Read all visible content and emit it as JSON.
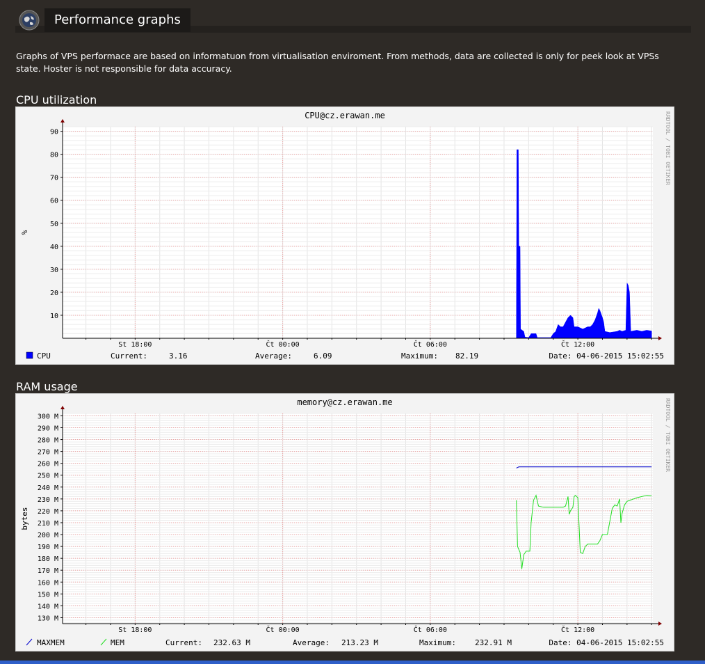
{
  "header": {
    "title": "Performance graphs",
    "icon": "globe-icon"
  },
  "intro": "Graphs of VPS performace are based on informatuon from virtualisation enviroment. From methods, data are collected is only for peek look at VPSs state. Hoster is not responsible for data accuracy.",
  "cpu": {
    "section_title": "CPU utilization",
    "chart_data": {
      "type": "area",
      "title": "CPU@cz.erawan.me",
      "ylabel": "%",
      "watermark": "RRDTOOL / TOBI OETIKER",
      "ylim": [
        0,
        92
      ],
      "yticks": [
        10,
        20,
        30,
        40,
        50,
        60,
        70,
        80,
        90
      ],
      "xticks": [
        "St 18:00",
        "Čt 00:00",
        "Čt 06:00",
        "Čt 12:00"
      ],
      "xtick_hours": [
        18,
        24,
        30,
        36
      ],
      "x_range_hours": [
        15.05,
        39.05
      ],
      "series": [
        {
          "name": "CPU",
          "color": "#0000ff",
          "points": [
            [
              33.5,
              0
            ],
            [
              33.52,
              82
            ],
            [
              33.58,
              82
            ],
            [
              33.6,
              40
            ],
            [
              33.65,
              40
            ],
            [
              33.67,
              4
            ],
            [
              33.8,
              3
            ],
            [
              33.85,
              0.5
            ],
            [
              34.0,
              0.3
            ],
            [
              34.1,
              2
            ],
            [
              34.3,
              2
            ],
            [
              34.35,
              0.3
            ],
            [
              34.9,
              0.3
            ],
            [
              35.0,
              2
            ],
            [
              35.1,
              3
            ],
            [
              35.2,
              6
            ],
            [
              35.3,
              5
            ],
            [
              35.4,
              5
            ],
            [
              35.5,
              7
            ],
            [
              35.6,
              9
            ],
            [
              35.7,
              10
            ],
            [
              35.8,
              9
            ],
            [
              35.85,
              5
            ],
            [
              36.0,
              5
            ],
            [
              36.2,
              4
            ],
            [
              36.4,
              5
            ],
            [
              36.5,
              5
            ],
            [
              36.6,
              6
            ],
            [
              36.7,
              8
            ],
            [
              36.8,
              11
            ],
            [
              36.85,
              13
            ],
            [
              36.9,
              12
            ],
            [
              37.0,
              9
            ],
            [
              37.05,
              7
            ],
            [
              37.1,
              3
            ],
            [
              37.3,
              2.5
            ],
            [
              37.6,
              3
            ],
            [
              37.7,
              3.5
            ],
            [
              37.8,
              3
            ],
            [
              37.95,
              3.5
            ],
            [
              38.0,
              24
            ],
            [
              38.05,
              23
            ],
            [
              38.1,
              20
            ],
            [
              38.15,
              3
            ],
            [
              38.4,
              3.5
            ],
            [
              38.6,
              3
            ],
            [
              38.8,
              3.5
            ],
            [
              39.0,
              3.16
            ]
          ]
        }
      ],
      "legend": {
        "label": "CPU",
        "current_label": "Current:",
        "current": "3.16",
        "average_label": "Average:",
        "average": "6.09",
        "maximum_label": "Maximum:",
        "maximum": "82.19",
        "date": "Date: 04-06-2015 15:02:55"
      }
    }
  },
  "ram": {
    "section_title": "RAM usage",
    "chart_data": {
      "type": "line",
      "title": "memory@cz.erawan.me",
      "ylabel": "bytes",
      "watermark": "RRDTOOL / TOBI OETIKER",
      "ylim": [
        125,
        302
      ],
      "yticks": [
        130,
        140,
        150,
        160,
        170,
        180,
        190,
        200,
        210,
        220,
        230,
        240,
        250,
        260,
        270,
        280,
        290,
        300
      ],
      "ytick_labels": [
        "130 M",
        "140 M",
        "150 M",
        "160 M",
        "170 M",
        "180 M",
        "190 M",
        "200 M",
        "210 M",
        "220 M",
        "230 M",
        "240 M",
        "250 M",
        "260 M",
        "270 M",
        "280 M",
        "290 M",
        "300 M"
      ],
      "xticks": [
        "St 18:00",
        "Čt 00:00",
        "Čt 06:00",
        "Čt 12:00"
      ],
      "xtick_hours": [
        18,
        24,
        30,
        36
      ],
      "x_range_hours": [
        15.05,
        39.05
      ],
      "series": [
        {
          "name": "MAXMEM",
          "color": "#0000cc",
          "points": [
            [
              33.5,
              256
            ],
            [
              33.6,
              257
            ],
            [
              39.0,
              257
            ]
          ]
        },
        {
          "name": "MEM",
          "color": "#22dd22",
          "points": [
            [
              33.5,
              229
            ],
            [
              33.55,
              190
            ],
            [
              33.65,
              185
            ],
            [
              33.72,
              171
            ],
            [
              33.8,
              183
            ],
            [
              33.9,
              186
            ],
            [
              34.05,
              186
            ],
            [
              34.1,
              210
            ],
            [
              34.2,
              229
            ],
            [
              34.3,
              233
            ],
            [
              34.4,
              224
            ],
            [
              34.6,
              223
            ],
            [
              35.4,
              223
            ],
            [
              35.5,
              224
            ],
            [
              35.6,
              232
            ],
            [
              35.65,
              217
            ],
            [
              35.7,
              220
            ],
            [
              35.8,
              223
            ],
            [
              35.85,
              232
            ],
            [
              35.9,
              233
            ],
            [
              36.0,
              231
            ],
            [
              36.1,
              185
            ],
            [
              36.2,
              184
            ],
            [
              36.3,
              190
            ],
            [
              36.4,
              192
            ],
            [
              36.8,
              192
            ],
            [
              36.9,
              195
            ],
            [
              37.0,
              200
            ],
            [
              37.2,
              200
            ],
            [
              37.4,
              222
            ],
            [
              37.5,
              225
            ],
            [
              37.6,
              224
            ],
            [
              37.7,
              230
            ],
            [
              37.75,
              210
            ],
            [
              37.8,
              218
            ],
            [
              37.9,
              225
            ],
            [
              38.0,
              228
            ],
            [
              38.4,
              231
            ],
            [
              38.8,
              233
            ],
            [
              39.0,
              232.63
            ]
          ]
        }
      ],
      "legend": {
        "label1": "MAXMEM",
        "label2": "MEM",
        "current_label": "Current:",
        "current": "232.63 M",
        "average_label": "Average:",
        "average": "213.23 M",
        "maximum_label": "Maximum:",
        "maximum": "232.91 M",
        "date": "Date: 04-06-2015 15:02:55"
      }
    }
  }
}
